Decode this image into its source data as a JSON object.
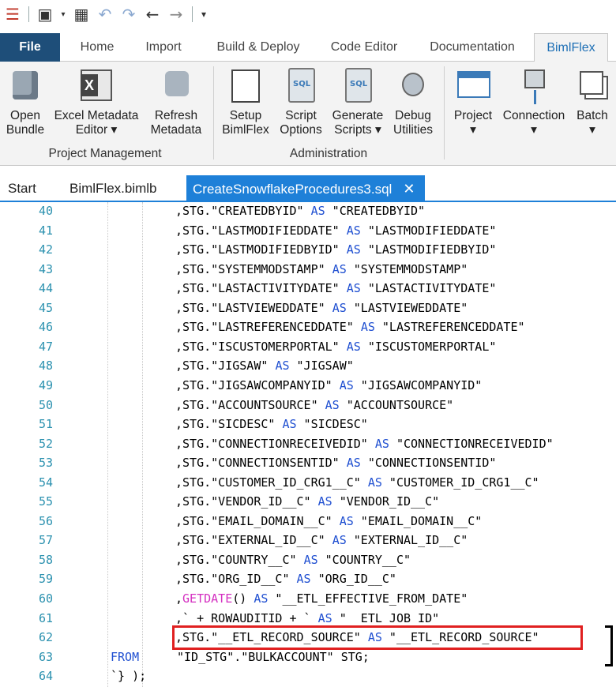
{
  "quick_access": {
    "icons": [
      "bimlflex-logo-icon",
      "build-icon",
      "dropdown-icon",
      "project-icon",
      "undo-icon",
      "redo-icon",
      "back-icon",
      "forward-icon",
      "customize-icon"
    ]
  },
  "ribbon_tabs": [
    {
      "label": "File"
    },
    {
      "label": "Home"
    },
    {
      "label": "Import"
    },
    {
      "label": "Build & Deploy"
    },
    {
      "label": "Code Editor"
    },
    {
      "label": "Documentation"
    },
    {
      "label": "BimlFlex"
    }
  ],
  "ribbon": {
    "buttons": [
      {
        "label": "Open\nBundle",
        "icon": "cube-icon"
      },
      {
        "label": "Excel Metadata\nEditor ▾",
        "icon": "excel-icon"
      },
      {
        "label": "Refresh\nMetadata",
        "icon": "puzzle-icon"
      },
      {
        "label": "Setup\nBimlFlex",
        "icon": "sliders-icon"
      },
      {
        "label": "Script\nOptions",
        "icon": "sql-doc-icon"
      },
      {
        "label": "Generate\nScripts ▾",
        "icon": "sql-doc-icon"
      },
      {
        "label": "Debug\nUtilities",
        "icon": "bug-icon"
      },
      {
        "label": "Project\n▾",
        "icon": "project-icon"
      },
      {
        "label": "Connection\n▾",
        "icon": "connection-icon"
      },
      {
        "label": "Batch\n▾",
        "icon": "batch-icon"
      }
    ],
    "groups": [
      {
        "label": "Project Management"
      },
      {
        "label": "Administration"
      }
    ]
  },
  "doc_tabs": [
    {
      "label": "Start"
    },
    {
      "label": "BimlFlex.bimlb"
    },
    {
      "label": "CreateSnowflakeProcedures3.sql",
      "close": "✕"
    }
  ],
  "editor": {
    "lines": [
      {
        "n": "40",
        "pre": ",STG.\"CREATEDBYID\" ",
        "kw": "AS",
        "post": " \"CREATEDBYID\""
      },
      {
        "n": "41",
        "pre": ",STG.\"LASTMODIFIEDDATE\" ",
        "kw": "AS",
        "post": " \"LASTMODIFIEDDATE\""
      },
      {
        "n": "42",
        "pre": ",STG.\"LASTMODIFIEDBYID\" ",
        "kw": "AS",
        "post": " \"LASTMODIFIEDBYID\""
      },
      {
        "n": "43",
        "pre": ",STG.\"SYSTEMMODSTAMP\" ",
        "kw": "AS",
        "post": " \"SYSTEMMODSTAMP\""
      },
      {
        "n": "44",
        "pre": ",STG.\"LASTACTIVITYDATE\" ",
        "kw": "AS",
        "post": " \"LASTACTIVITYDATE\""
      },
      {
        "n": "45",
        "pre": ",STG.\"LASTVIEWEDDATE\" ",
        "kw": "AS",
        "post": " \"LASTVIEWEDDATE\""
      },
      {
        "n": "46",
        "pre": ",STG.\"LASTREFERENCEDDATE\" ",
        "kw": "AS",
        "post": " \"LASTREFERENCEDDATE\""
      },
      {
        "n": "47",
        "pre": ",STG.\"ISCUSTOMERPORTAL\" ",
        "kw": "AS",
        "post": " \"ISCUSTOMERPORTAL\""
      },
      {
        "n": "48",
        "pre": ",STG.\"JIGSAW\" ",
        "kw": "AS",
        "post": " \"JIGSAW\""
      },
      {
        "n": "49",
        "pre": ",STG.\"JIGSAWCOMPANYID\" ",
        "kw": "AS",
        "post": " \"JIGSAWCOMPANYID\""
      },
      {
        "n": "50",
        "pre": ",STG.\"ACCOUNTSOURCE\" ",
        "kw": "AS",
        "post": " \"ACCOUNTSOURCE\""
      },
      {
        "n": "51",
        "pre": ",STG.\"SICDESC\" ",
        "kw": "AS",
        "post": " \"SICDESC\""
      },
      {
        "n": "52",
        "pre": ",STG.\"CONNECTIONRECEIVEDID\" ",
        "kw": "AS",
        "post": " \"CONNECTIONRECEIVEDID\""
      },
      {
        "n": "53",
        "pre": ",STG.\"CONNECTIONSENTID\" ",
        "kw": "AS",
        "post": " \"CONNECTIONSENTID\""
      },
      {
        "n": "54",
        "pre": ",STG.\"CUSTOMER_ID_CRG1__C\" ",
        "kw": "AS",
        "post": " \"CUSTOMER_ID_CRG1__C\""
      },
      {
        "n": "55",
        "pre": ",STG.\"VENDOR_ID__C\" ",
        "kw": "AS",
        "post": " \"VENDOR_ID__C\""
      },
      {
        "n": "56",
        "pre": ",STG.\"EMAIL_DOMAIN__C\" ",
        "kw": "AS",
        "post": " \"EMAIL_DOMAIN__C\""
      },
      {
        "n": "57",
        "pre": ",STG.\"EXTERNAL_ID__C\" ",
        "kw": "AS",
        "post": " \"EXTERNAL_ID__C\""
      },
      {
        "n": "58",
        "pre": ",STG.\"COUNTRY__C\" ",
        "kw": "AS",
        "post": " \"COUNTRY__C\""
      },
      {
        "n": "59",
        "pre": ",STG.\"ORG_ID__C\" ",
        "kw": "AS",
        "post": " \"ORG_ID__C\""
      },
      {
        "n": "60",
        "pre": ",",
        "fn": "GETDATE",
        "mid": "() ",
        "kw": "AS",
        "post": " \"__ETL_EFFECTIVE_FROM_DATE\""
      },
      {
        "n": "61",
        "pre": ",` + ROWAUDITID + ` ",
        "kw": "AS",
        "post": " \"  ETL JOB ID\""
      },
      {
        "n": "62",
        "pre": ",STG.\"__ETL_RECORD_SOURCE\" ",
        "kw": "AS",
        "post": " \"__ETL_RECORD_SOURCE\""
      },
      {
        "n": "63",
        "from": "FROM",
        "pre": "\"ID_STG\".\"BULKACCOUNT\" STG;"
      },
      {
        "n": "64",
        "close": "`} );"
      }
    ]
  }
}
